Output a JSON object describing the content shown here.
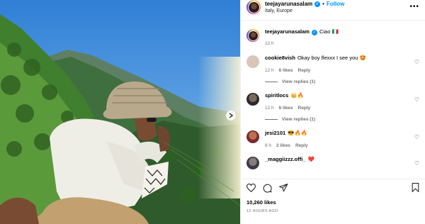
{
  "post": {
    "username": "teejayarunasalam",
    "follow_label": "Follow",
    "dot": "•",
    "location": "Italy, Europe",
    "more_glyph": "•••"
  },
  "caption": {
    "username": "teejayarunasalam",
    "text": "Ciao 🇮🇹",
    "age": "12 h"
  },
  "comments": [
    {
      "username": "cookie8vish",
      "text": "Okay boy flexxx I see you 🤩",
      "age": "12 h",
      "likes": "6 likes",
      "reply": "Reply",
      "view_replies": "View replies (1)",
      "avatar_color": "#d9c6b8"
    },
    {
      "username": "spiritlocs",
      "text": "👑🔥",
      "age": "12 h",
      "likes": "6 likes",
      "reply": "Reply",
      "view_replies": "View replies (1)",
      "avatar_color": "#3a3a3a"
    },
    {
      "username": "jesi2101",
      "text": "😎🔥🔥",
      "age": "8 h",
      "likes": "2 likes",
      "reply": "Reply",
      "avatar_color": "#a23a3a"
    },
    {
      "username": "_maggiizzz.offi_",
      "text": "❤️",
      "avatar_color": "#5a5a6a"
    }
  ],
  "footer": {
    "likes": "10,260 likes",
    "time_ago": "12 HOURS AGO"
  },
  "icons": {
    "heart": "heart-icon",
    "comment": "comment-icon",
    "share": "share-icon",
    "save": "bookmark-icon",
    "next": "chevron-right-icon",
    "verified": "verified-badge-icon"
  },
  "colors": {
    "accent": "#0095f6",
    "meta": "#737373"
  }
}
